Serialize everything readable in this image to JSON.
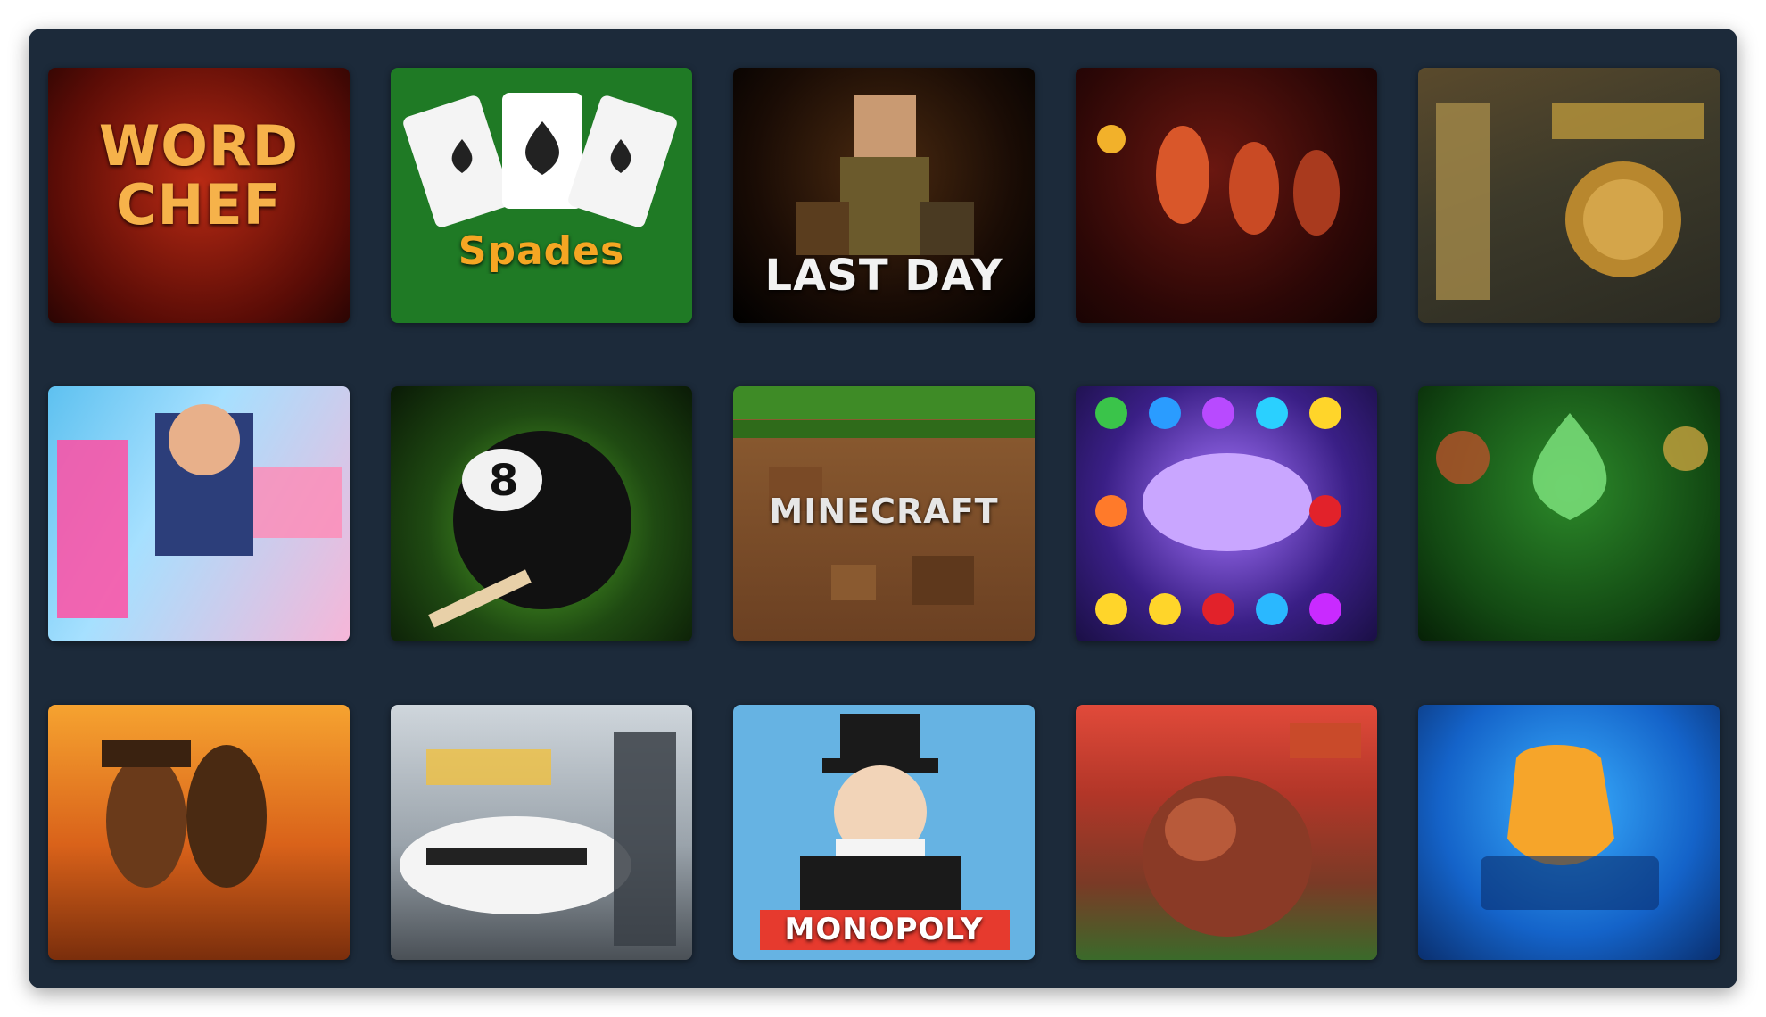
{
  "games": [
    {
      "title": "WORD\nCHEF",
      "color": "#f6b24a"
    },
    {
      "title": "Spades",
      "color": "#f5a623"
    },
    {
      "title": "LAST DAY",
      "color": "#f2f2f2"
    },
    {
      "title": "",
      "color": "#ffffff"
    },
    {
      "title": "",
      "color": "#f0c040"
    },
    {
      "title": "",
      "color": "#ffffff"
    },
    {
      "title": "",
      "color": "#ffffff"
    },
    {
      "title": "MINECRAFT",
      "color": "#e6e6e6"
    },
    {
      "title": "",
      "color": "#ffffff"
    },
    {
      "title": "",
      "color": "#f0b428"
    },
    {
      "title": "",
      "color": "#f2f2f2"
    },
    {
      "title": "",
      "color": "#f0c040"
    },
    {
      "title": "MONOPOLY",
      "color": "#e63a2e"
    },
    {
      "title": "",
      "color": "#ffffff"
    },
    {
      "title": "",
      "color": "#f7c948"
    }
  ]
}
